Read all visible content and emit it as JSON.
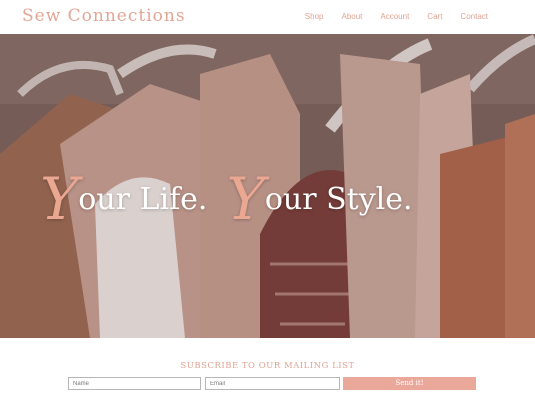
{
  "brand": "Sew Connections",
  "nav": [
    "Shop",
    "About",
    "Account",
    "Cart",
    "Contact"
  ],
  "hero": {
    "headline_line1_cap": "Y",
    "headline_line1_rest": "our Life.",
    "headline_line2_cap": "Y",
    "headline_line2_rest": "our Style."
  },
  "subscribe": {
    "title": "SUBSCRIBE TO OUR MAILING LIST",
    "name_placeholder": "Name",
    "email_placeholder": "Email",
    "button": "Send it!"
  },
  "colors": {
    "accent": "#e3a695",
    "button": "#eaa89a"
  }
}
